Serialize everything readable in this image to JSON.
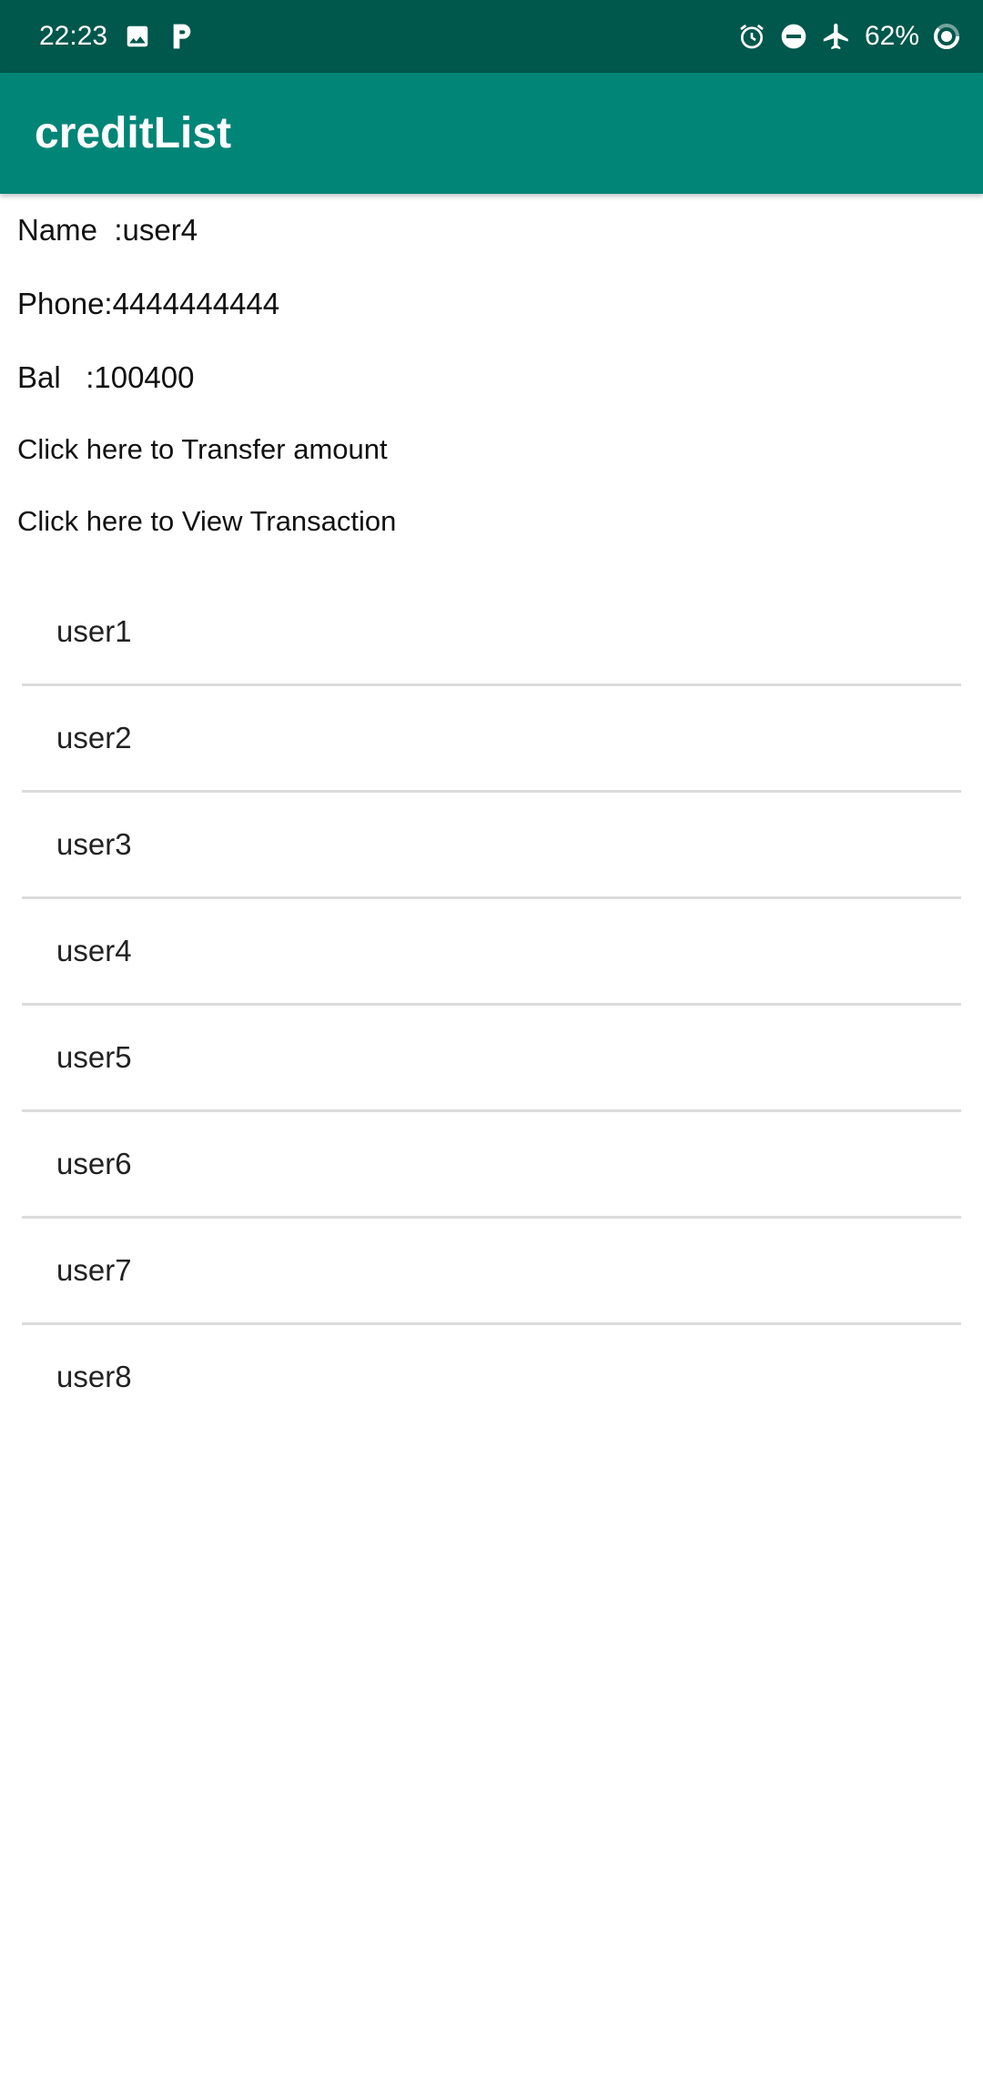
{
  "status_bar": {
    "time": "22:23",
    "battery": "62%",
    "icons": [
      "image-icon",
      "p-notification-icon",
      "alarm-icon",
      "do-not-disturb-icon",
      "airplane-icon",
      "battery-ring-icon"
    ]
  },
  "app_bar": {
    "title": "creditList"
  },
  "details": {
    "name": "Name  :user4",
    "phone": "Phone:4444444444",
    "balance": "Bal   :100400",
    "transfer_link": "Click here to Transfer amount",
    "view_link": "Click here to View Transaction"
  },
  "users": [
    {
      "label": "user1"
    },
    {
      "label": "user2"
    },
    {
      "label": "user3"
    },
    {
      "label": "user4"
    },
    {
      "label": "user5"
    },
    {
      "label": "user6"
    },
    {
      "label": "user7"
    },
    {
      "label": "user8"
    }
  ],
  "colors": {
    "status_bar": "#00574b",
    "app_bar": "#008577",
    "divider": "#dcdcdc"
  }
}
